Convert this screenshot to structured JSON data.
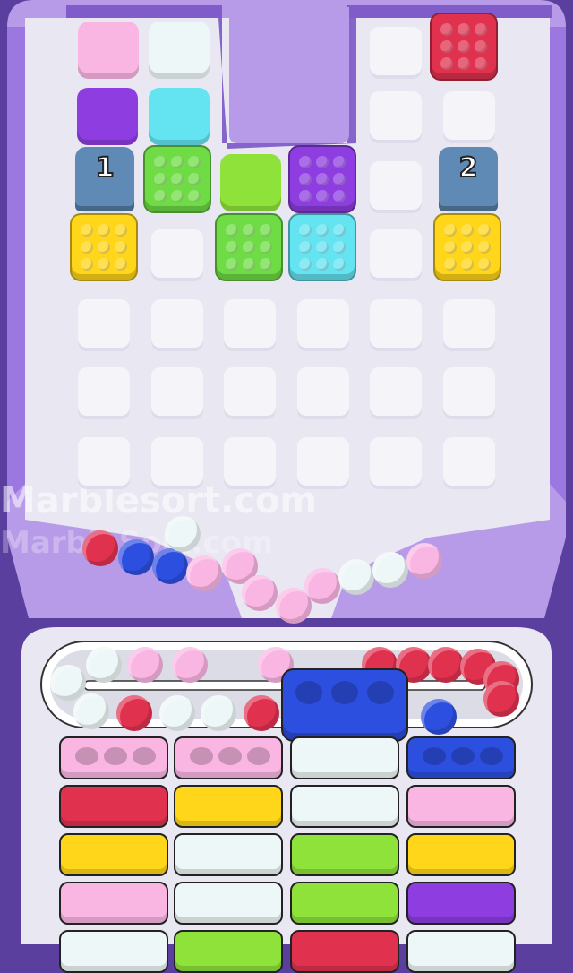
{
  "watermark": {
    "primary": "Marblesort.com",
    "secondary": "MarbleSort.com"
  },
  "colors": {
    "board_bg": "#e9e7f1",
    "frame": "#b89be8",
    "frame_dark": "#7a55c8",
    "pink": "#f9b6e3",
    "white": "#eef7f7",
    "purple": "#8e3ee0",
    "cyan": "#64e3f1",
    "lime": "#8fe23a",
    "green": "#6fdc46",
    "red": "#e0324f",
    "yellow": "#ffd61a",
    "blue": "#2d4fe0",
    "dark_blue": "#233cc0"
  },
  "tunnels": [
    {
      "number": "1"
    },
    {
      "number": "2"
    }
  ],
  "blocks_top": [
    {
      "color": "pink",
      "kind": "flat"
    },
    {
      "color": "white",
      "kind": "flat"
    },
    {
      "color": "red",
      "kind": "bumpy"
    },
    {
      "color": "purple",
      "kind": "flat"
    },
    {
      "color": "cyan",
      "kind": "flat"
    },
    {
      "color": "green",
      "kind": "bumpy"
    },
    {
      "color": "lime",
      "kind": "flat"
    },
    {
      "color": "purple",
      "kind": "bumpy"
    },
    {
      "color": "yellow",
      "kind": "bumpy"
    },
    {
      "color": "green",
      "kind": "bumpy"
    },
    {
      "color": "cyan",
      "kind": "bumpy"
    },
    {
      "color": "yellow",
      "kind": "bumpy"
    }
  ],
  "funnel_balls": [
    "red",
    "blue",
    "blue",
    "white",
    "pink",
    "pink",
    "pink",
    "pink",
    "pink",
    "white",
    "white",
    "pink"
  ],
  "conveyor_balls": [
    "white",
    "white",
    "pink",
    "pink",
    "pink",
    "red",
    "red",
    "red",
    "red",
    "red",
    "white",
    "red",
    "white",
    "white",
    "red",
    "blue",
    "red"
  ],
  "picker_block": {
    "color": "blue",
    "holes": 3
  },
  "columns": [
    [
      "pink_holes",
      "red",
      "yellow",
      "pink",
      "white"
    ],
    [
      "pink_holes",
      "yellow",
      "white",
      "white",
      "lime"
    ],
    [
      "white",
      "white",
      "lime",
      "lime",
      "red"
    ],
    [
      "blue_holes",
      "pink",
      "yellow",
      "purple",
      "white"
    ]
  ]
}
